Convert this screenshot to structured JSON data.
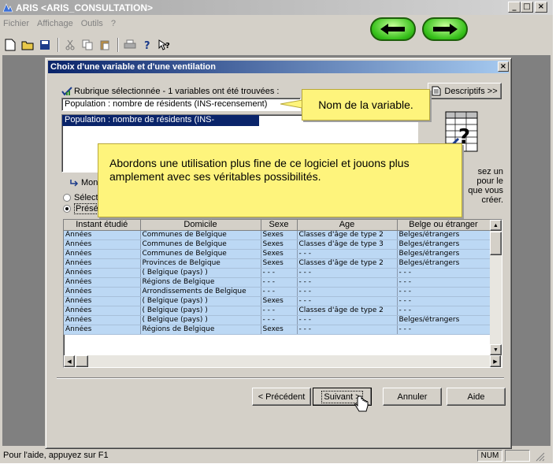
{
  "app": {
    "title": "ARIS <ARIS_CONSULTATION>",
    "menu": [
      "Fichier",
      "Affichage",
      "Outils",
      "?"
    ],
    "status": "Pour l'aide, appuyez sur F1",
    "num_indicator": "NUM"
  },
  "dialog": {
    "title": "Choix d'une variable et d'une ventilation",
    "rubrique_label": "Rubrique sélectionnée - 1 variables ont été trouvées :",
    "variable_value": "Population : nombre de résidents (INS-recensement)",
    "list_items": [
      "Population : nombre de résidents (INS-recensement)"
    ],
    "descriptifs_button": "Descriptifs >>",
    "montrer_label": "Mont",
    "radio1_label": "Sélect",
    "radio2_label": "Présé",
    "right_text": [
      "sez un",
      "pour le",
      "que vous",
      "créer."
    ],
    "grid": {
      "columns": [
        "Instant étudié",
        "Domicile",
        "Sexe",
        "Age",
        "Belge ou étranger"
      ],
      "rows": [
        [
          "Années",
          "Communes de Belgique",
          "Sexes",
          "Classes d'âge de type 2",
          "Belges/étrangers"
        ],
        [
          "Années",
          "Communes de Belgique",
          "Sexes",
          "Classes d'âge de type 3",
          "Belges/étrangers"
        ],
        [
          "Années",
          "Communes de Belgique",
          "Sexes",
          "- - -",
          "Belges/étrangers"
        ],
        [
          "Années",
          "Provinces de Belgique",
          "Sexes",
          "Classes d'âge de type 2",
          "Belges/étrangers"
        ],
        [
          "Années",
          "( Belgique (pays) )",
          "- - -",
          "- - -",
          "- - -"
        ],
        [
          "Années",
          "Régions de Belgique",
          "- - -",
          "- - -",
          "- - -"
        ],
        [
          "Années",
          "Arrondissements de Belgique",
          "- - -",
          "- - -",
          "- - -"
        ],
        [
          "Années",
          "( Belgique (pays) )",
          "Sexes",
          "- - -",
          "- - -"
        ],
        [
          "Années",
          "( Belgique (pays) )",
          "- - -",
          "Classes d'âge de type 2",
          "- - -"
        ],
        [
          "Années",
          "( Belgique (pays) )",
          "- - -",
          "- - -",
          "Belges/étrangers"
        ],
        [
          "Années",
          "Régions de Belgique",
          "Sexes",
          "- - -",
          "- - -"
        ]
      ]
    },
    "buttons": {
      "precedent": "< Précédent",
      "suivant": "Suivant >",
      "annuler": "Annuler",
      "aide": "Aide"
    }
  },
  "callouts": {
    "variable_note": "Nom de la variable.",
    "intro_note": "Abordons une utilisation plus fine de ce logiciel et jouons plus amplement avec ses véritables possibilités."
  },
  "colors": {
    "titlebar_active": "#0a246a",
    "grid_row": "#bcd8f4",
    "callout": "#fef47c",
    "nav_green": "#36c01a"
  }
}
